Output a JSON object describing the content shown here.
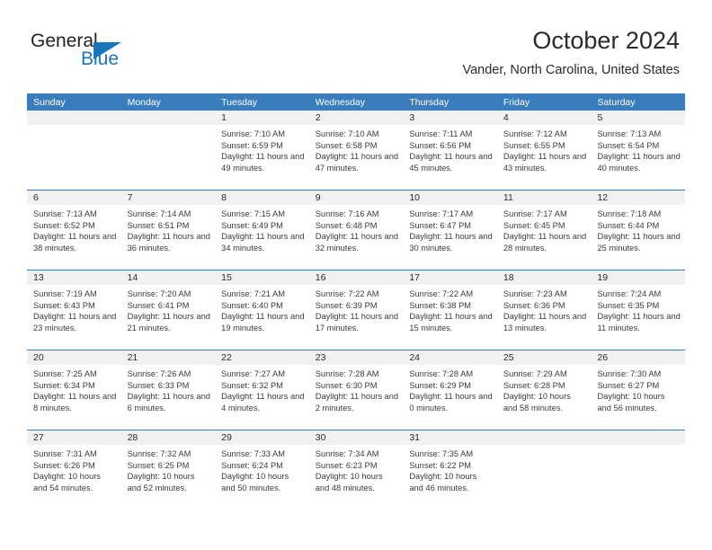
{
  "brand": {
    "name_part1": "General",
    "name_part2": "Blue",
    "triangle_color": "#1b75bb"
  },
  "header": {
    "title": "October 2024",
    "subtitle": "Vander, North Carolina, United States"
  },
  "theme": {
    "header_blue": "#3a7dbd",
    "day_band_gray": "#f1f1f1",
    "text_dark": "#2b2b2b"
  },
  "weekday_headers": [
    "Sunday",
    "Monday",
    "Tuesday",
    "Wednesday",
    "Thursday",
    "Friday",
    "Saturday"
  ],
  "weeks": [
    [
      {
        "day": "",
        "sunrise": "",
        "sunset": "",
        "daylight": "",
        "empty": true
      },
      {
        "day": "",
        "sunrise": "",
        "sunset": "",
        "daylight": "",
        "empty": true
      },
      {
        "day": "1",
        "sunrise": "Sunrise: 7:10 AM",
        "sunset": "Sunset: 6:59 PM",
        "daylight": "Daylight: 11 hours and 49 minutes."
      },
      {
        "day": "2",
        "sunrise": "Sunrise: 7:10 AM",
        "sunset": "Sunset: 6:58 PM",
        "daylight": "Daylight: 11 hours and 47 minutes."
      },
      {
        "day": "3",
        "sunrise": "Sunrise: 7:11 AM",
        "sunset": "Sunset: 6:56 PM",
        "daylight": "Daylight: 11 hours and 45 minutes."
      },
      {
        "day": "4",
        "sunrise": "Sunrise: 7:12 AM",
        "sunset": "Sunset: 6:55 PM",
        "daylight": "Daylight: 11 hours and 43 minutes."
      },
      {
        "day": "5",
        "sunrise": "Sunrise: 7:13 AM",
        "sunset": "Sunset: 6:54 PM",
        "daylight": "Daylight: 11 hours and 40 minutes."
      }
    ],
    [
      {
        "day": "6",
        "sunrise": "Sunrise: 7:13 AM",
        "sunset": "Sunset: 6:52 PM",
        "daylight": "Daylight: 11 hours and 38 minutes."
      },
      {
        "day": "7",
        "sunrise": "Sunrise: 7:14 AM",
        "sunset": "Sunset: 6:51 PM",
        "daylight": "Daylight: 11 hours and 36 minutes."
      },
      {
        "day": "8",
        "sunrise": "Sunrise: 7:15 AM",
        "sunset": "Sunset: 6:49 PM",
        "daylight": "Daylight: 11 hours and 34 minutes."
      },
      {
        "day": "9",
        "sunrise": "Sunrise: 7:16 AM",
        "sunset": "Sunset: 6:48 PM",
        "daylight": "Daylight: 11 hours and 32 minutes."
      },
      {
        "day": "10",
        "sunrise": "Sunrise: 7:17 AM",
        "sunset": "Sunset: 6:47 PM",
        "daylight": "Daylight: 11 hours and 30 minutes."
      },
      {
        "day": "11",
        "sunrise": "Sunrise: 7:17 AM",
        "sunset": "Sunset: 6:45 PM",
        "daylight": "Daylight: 11 hours and 28 minutes."
      },
      {
        "day": "12",
        "sunrise": "Sunrise: 7:18 AM",
        "sunset": "Sunset: 6:44 PM",
        "daylight": "Daylight: 11 hours and 25 minutes."
      }
    ],
    [
      {
        "day": "13",
        "sunrise": "Sunrise: 7:19 AM",
        "sunset": "Sunset: 6:43 PM",
        "daylight": "Daylight: 11 hours and 23 minutes."
      },
      {
        "day": "14",
        "sunrise": "Sunrise: 7:20 AM",
        "sunset": "Sunset: 6:41 PM",
        "daylight": "Daylight: 11 hours and 21 minutes."
      },
      {
        "day": "15",
        "sunrise": "Sunrise: 7:21 AM",
        "sunset": "Sunset: 6:40 PM",
        "daylight": "Daylight: 11 hours and 19 minutes."
      },
      {
        "day": "16",
        "sunrise": "Sunrise: 7:22 AM",
        "sunset": "Sunset: 6:39 PM",
        "daylight": "Daylight: 11 hours and 17 minutes."
      },
      {
        "day": "17",
        "sunrise": "Sunrise: 7:22 AM",
        "sunset": "Sunset: 6:38 PM",
        "daylight": "Daylight: 11 hours and 15 minutes."
      },
      {
        "day": "18",
        "sunrise": "Sunrise: 7:23 AM",
        "sunset": "Sunset: 6:36 PM",
        "daylight": "Daylight: 11 hours and 13 minutes."
      },
      {
        "day": "19",
        "sunrise": "Sunrise: 7:24 AM",
        "sunset": "Sunset: 6:35 PM",
        "daylight": "Daylight: 11 hours and 11 minutes."
      }
    ],
    [
      {
        "day": "20",
        "sunrise": "Sunrise: 7:25 AM",
        "sunset": "Sunset: 6:34 PM",
        "daylight": "Daylight: 11 hours and 8 minutes."
      },
      {
        "day": "21",
        "sunrise": "Sunrise: 7:26 AM",
        "sunset": "Sunset: 6:33 PM",
        "daylight": "Daylight: 11 hours and 6 minutes."
      },
      {
        "day": "22",
        "sunrise": "Sunrise: 7:27 AM",
        "sunset": "Sunset: 6:32 PM",
        "daylight": "Daylight: 11 hours and 4 minutes."
      },
      {
        "day": "23",
        "sunrise": "Sunrise: 7:28 AM",
        "sunset": "Sunset: 6:30 PM",
        "daylight": "Daylight: 11 hours and 2 minutes."
      },
      {
        "day": "24",
        "sunrise": "Sunrise: 7:28 AM",
        "sunset": "Sunset: 6:29 PM",
        "daylight": "Daylight: 11 hours and 0 minutes."
      },
      {
        "day": "25",
        "sunrise": "Sunrise: 7:29 AM",
        "sunset": "Sunset: 6:28 PM",
        "daylight": "Daylight: 10 hours and 58 minutes."
      },
      {
        "day": "26",
        "sunrise": "Sunrise: 7:30 AM",
        "sunset": "Sunset: 6:27 PM",
        "daylight": "Daylight: 10 hours and 56 minutes."
      }
    ],
    [
      {
        "day": "27",
        "sunrise": "Sunrise: 7:31 AM",
        "sunset": "Sunset: 6:26 PM",
        "daylight": "Daylight: 10 hours and 54 minutes."
      },
      {
        "day": "28",
        "sunrise": "Sunrise: 7:32 AM",
        "sunset": "Sunset: 6:25 PM",
        "daylight": "Daylight: 10 hours and 52 minutes."
      },
      {
        "day": "29",
        "sunrise": "Sunrise: 7:33 AM",
        "sunset": "Sunset: 6:24 PM",
        "daylight": "Daylight: 10 hours and 50 minutes."
      },
      {
        "day": "30",
        "sunrise": "Sunrise: 7:34 AM",
        "sunset": "Sunset: 6:23 PM",
        "daylight": "Daylight: 10 hours and 48 minutes."
      },
      {
        "day": "31",
        "sunrise": "Sunrise: 7:35 AM",
        "sunset": "Sunset: 6:22 PM",
        "daylight": "Daylight: 10 hours and 46 minutes."
      },
      {
        "day": "",
        "sunrise": "",
        "sunset": "",
        "daylight": "",
        "empty": true
      },
      {
        "day": "",
        "sunrise": "",
        "sunset": "",
        "daylight": "",
        "empty": true
      }
    ]
  ]
}
